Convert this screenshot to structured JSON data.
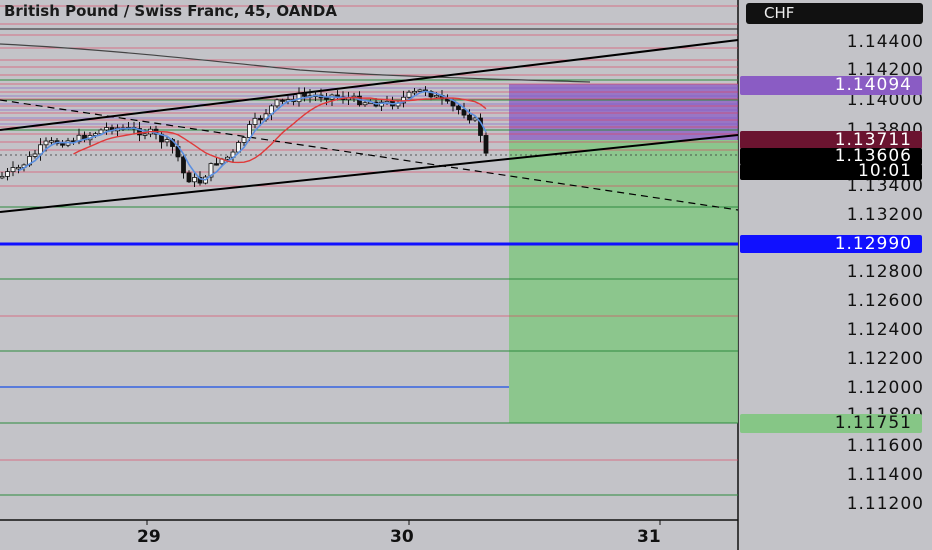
{
  "header": {
    "symbol_title": "British Pound / Swiss Franc, 45, OANDA"
  },
  "currency": {
    "label": "CHF"
  },
  "price_axis": {
    "labels": [
      "1.14400",
      "1.14200",
      "1.14000",
      "1.13800",
      "1.13400",
      "1.13200",
      "1.12800",
      "1.12600",
      "1.12400",
      "1.12200",
      "1.12000",
      "1.11600",
      "1.11400",
      "1.11200"
    ],
    "obscured_label": "1.11800"
  },
  "badges": {
    "upper_zone": "1.14094",
    "lower_zone": "1.13711",
    "last_price": "1.13606",
    "countdown": "10:01",
    "blue_level": "1.12990",
    "target": "1.11751"
  },
  "time_axis": {
    "labels": [
      "29",
      "30",
      "31"
    ]
  },
  "colors": {
    "background": "#c3c3c8",
    "purple_zone": "#8a5cc4",
    "green_zone": "#86c686",
    "blue_level": "#1010ff",
    "red_line": "#e23a5a",
    "green_line": "#2e8b3e",
    "ma_blue": "#5b8fe0",
    "ma_red": "#e03a3a"
  }
}
